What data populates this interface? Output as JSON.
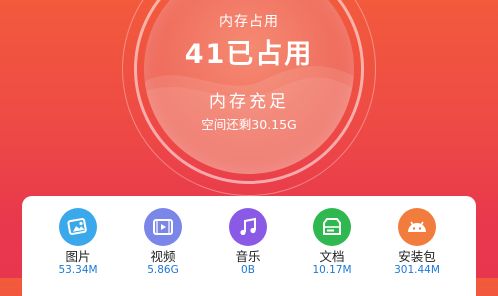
{
  "memory_meter": {
    "label": "内存占用",
    "used_text": "41已占用",
    "status": "内存充足",
    "free_text": "空间还剩30.15G"
  },
  "categories": [
    {
      "name": "图片",
      "size": "53.34M",
      "icon": "image-icon",
      "color": "#3aa8ea"
    },
    {
      "name": "视频",
      "size": "5.86G",
      "icon": "video-icon",
      "color": "#7a86e8"
    },
    {
      "name": "音乐",
      "size": "0B",
      "icon": "music-icon",
      "color": "#8a5ae6"
    },
    {
      "name": "文档",
      "size": "10.17M",
      "icon": "document-icon",
      "color": "#2fb84f"
    },
    {
      "name": "安装包",
      "size": "301.44M",
      "icon": "android-package-icon",
      "color": "#f27c3d"
    }
  ]
}
